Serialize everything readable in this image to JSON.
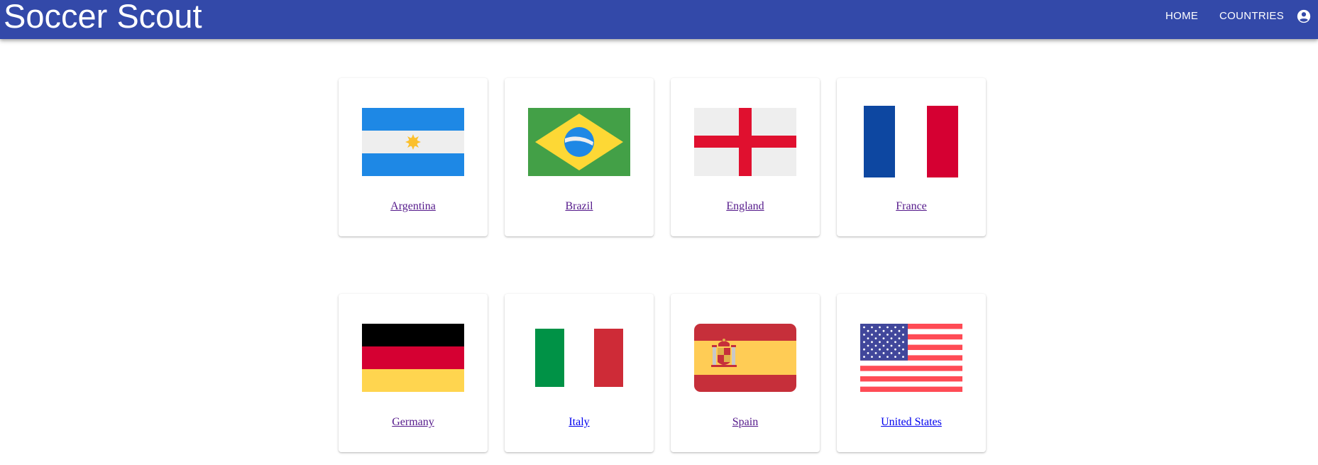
{
  "app": {
    "title": "Soccer Scout"
  },
  "nav": {
    "home": "HOME",
    "countries": "COUNTRIES",
    "account_icon": "account-circle-icon"
  },
  "countries": [
    {
      "name": "Argentina",
      "flag_icon": "argentina-flag-icon"
    },
    {
      "name": "Brazil",
      "flag_icon": "brazil-flag-icon"
    },
    {
      "name": "England",
      "flag_icon": "england-flag-icon"
    },
    {
      "name": "France",
      "flag_icon": "france-flag-icon"
    },
    {
      "name": "Germany",
      "flag_icon": "germany-flag-icon"
    },
    {
      "name": "Italy",
      "flag_icon": "italy-flag-icon"
    },
    {
      "name": "Spain",
      "flag_icon": "spain-flag-icon"
    },
    {
      "name": "United States",
      "flag_icon": "united-states-flag-icon"
    }
  ],
  "colors": {
    "appbar": "#3349a9",
    "link_visited": "#551a8b",
    "link_unvisited": "#0000ee"
  }
}
